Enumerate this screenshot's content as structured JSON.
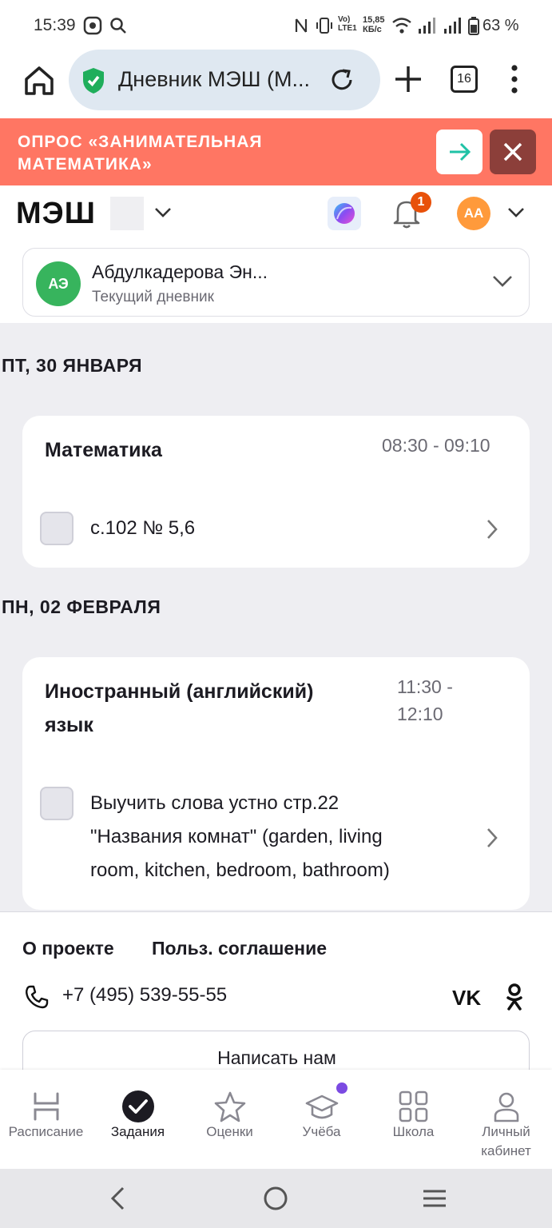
{
  "status_bar": {
    "time": "15:39",
    "net_speed": "15,85 КБ/с",
    "volte": "Vo) LTE1",
    "battery": "63 %"
  },
  "browser": {
    "url_title": "Дневник МЭШ (М...",
    "tab_count": "16"
  },
  "banner": {
    "text": "ОПРОС «ЗАНИМАТЕЛЬНАЯ МАТЕМАТИКА»"
  },
  "header": {
    "logo": "МЭШ",
    "notification_count": "1",
    "user_initials": "АА"
  },
  "student": {
    "initials": "АЭ",
    "name": "Абдулкадерова Эн...",
    "subtitle": "Текущий дневник"
  },
  "days": [
    {
      "heading": "ПТ, 30 ЯНВАРЯ",
      "lesson": {
        "subject": "Математика",
        "time": "08:30 - 09:10",
        "task": "с.102 № 5,6"
      }
    },
    {
      "heading": "ПН, 02 ФЕВРАЛЯ",
      "lesson": {
        "subject_line1": "Иностранный (английский)",
        "subject_line2": "язык",
        "time_line1": "11:30 -",
        "time_line2": "12:10",
        "task_line1": "Выучить слова устно стр.22",
        "task_line2": "\"Названия комнат\" (garden, living",
        "task_line3": "room, kitchen, bedroom, bathroom)"
      }
    }
  ],
  "footer": {
    "about": "О проекте",
    "agreement": "Польз. соглашение",
    "phone": "+7 (495) 539-55-55",
    "vk": "VK",
    "write_button": "Написать нам"
  },
  "bottom_nav": [
    {
      "label": "Расписание",
      "active": false
    },
    {
      "label": "Задания",
      "active": true
    },
    {
      "label": "Оценки",
      "active": false
    },
    {
      "label": "Учёба",
      "active": false,
      "dot": true
    },
    {
      "label": "Школа",
      "active": false
    },
    {
      "label_line1": "Личный",
      "label_line2": "кабинет",
      "active": false
    }
  ],
  "colors": {
    "banner_bg": "#ff7663",
    "banner_close_bg": "#8c3f3a",
    "accent_green": "#37b45d",
    "badge_orange": "#e8510a",
    "avatar_orange": "#ff9a3b",
    "nav_dot": "#7b4ae2"
  }
}
